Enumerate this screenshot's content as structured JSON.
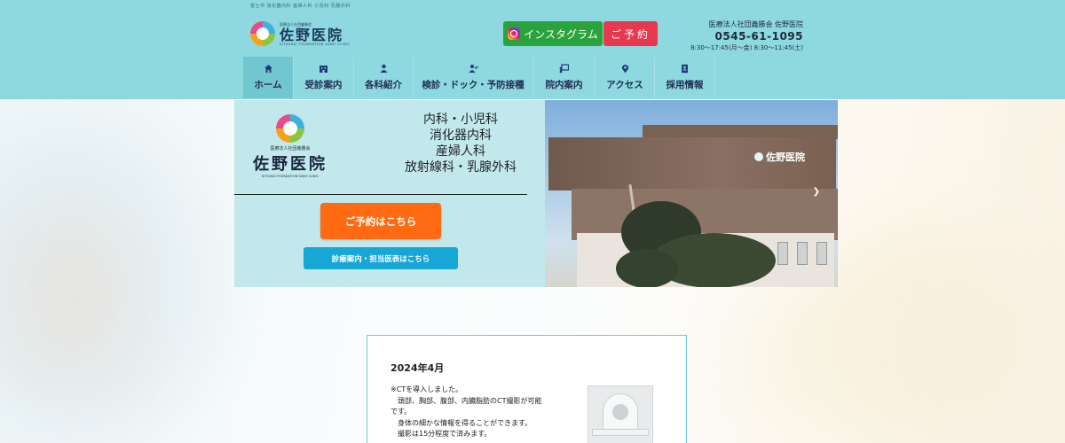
{
  "topbar": {
    "text": "富士市 消化器内科 産婦人科 小児科 乳腺外科"
  },
  "logo": {
    "sub": "医療法人社団義勝会",
    "main": "佐野医院",
    "en": "KITSUKAI FOUNDATION SANO CLINIC"
  },
  "header_buttons": {
    "instagram": "インスタグラム",
    "reserve": "ご予約"
  },
  "contact": {
    "org": "医療法人社団義勝会 佐野医院",
    "tel": "0545-61-1095",
    "hours": "8:30～17:45(月～金) 8:30～11:45(土)"
  },
  "nav": [
    {
      "label": "ホーム",
      "icon": "home-icon"
    },
    {
      "label": "受診案内",
      "icon": "building-icon"
    },
    {
      "label": "各科紹介",
      "icon": "users-icon"
    },
    {
      "label": "検診・ドック・予防接種",
      "icon": "user-check-icon"
    },
    {
      "label": "院内案内",
      "icon": "chalkboard-icon"
    },
    {
      "label": "アクセス",
      "icon": "map-pin-icon"
    },
    {
      "label": "採用情報",
      "icon": "id-card-icon"
    }
  ],
  "hero": {
    "logo_sub": "医療法人社団義勝会",
    "logo_main": "佐野医院",
    "logo_en": "KITSUKAI FOUNDATION SANO CLINIC",
    "departments": [
      "内科・小児科",
      "消化器内科",
      "産婦人科",
      "放射線科・乳腺外科"
    ],
    "reserve_button": "ご予約はこちら",
    "schedule_button": "診療案内・担当医表はこちら",
    "building_sign": "佐野医院"
  },
  "news": {
    "date": "2024年4月",
    "lines": [
      "※CTを導入しました。",
      "　頭部、胸部、腹部、内臓脂肪のCT撮影が可能",
      "です。",
      "　身体の細かな情報を得ることができます。",
      "　撮影は15分程度で済みます。"
    ]
  },
  "colors": {
    "header_bg": "#8ed8df",
    "nav_active": "#71c6cf",
    "instagram_green": "#2aa33c",
    "reserve_red": "#e6394d",
    "reserve_orange": "#ff6a13",
    "schedule_blue": "#17a7d6"
  }
}
